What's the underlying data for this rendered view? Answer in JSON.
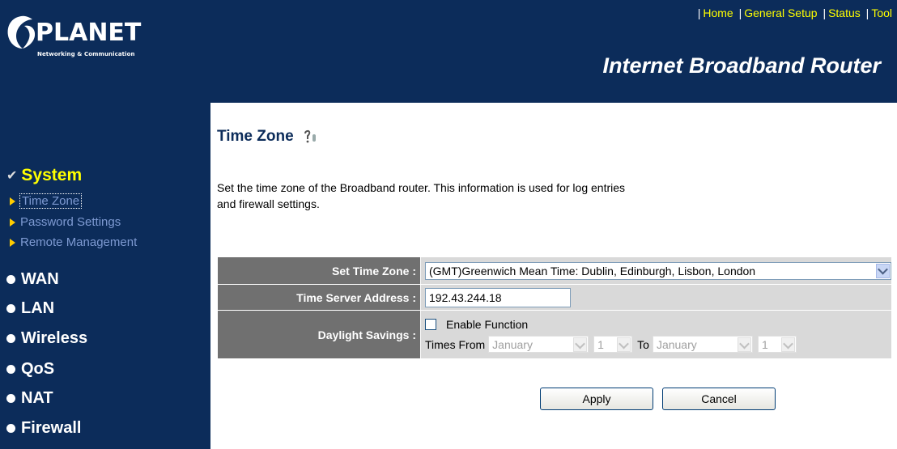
{
  "brand": {
    "name": "PLANET",
    "tagline": "Networking & Communication"
  },
  "top_nav": [
    "Home",
    "General Setup",
    "Status",
    "Tool"
  ],
  "product_title": "Internet Broadband Router",
  "sidebar": {
    "system_label": "System",
    "system_items": [
      "Time Zone",
      "Password Settings",
      "Remote Management"
    ],
    "sections": [
      "WAN",
      "LAN",
      "Wireless",
      "QoS",
      "NAT",
      "Firewall"
    ]
  },
  "page": {
    "title": "Time Zone",
    "description_line1": "Set the time zone of the Broadband router. This information is used for log entries",
    "description_line2": "and firewall settings."
  },
  "form": {
    "time_zone_label": "Set Time Zone :",
    "time_zone_value": "(GMT)Greenwich Mean Time: Dublin, Edinburgh, Lisbon, London",
    "server_label": "Time Server Address :",
    "server_value": "192.43.244.18",
    "daylight_label": "Daylight Savings :",
    "enable_label": "Enable Function",
    "enable_checked": false,
    "times_from_label": "Times From",
    "from_month": "January",
    "from_day": "1",
    "to_label": "To",
    "to_month": "January",
    "to_day": "1"
  },
  "buttons": {
    "apply": "Apply",
    "cancel": "Cancel"
  },
  "colors": {
    "header_bg": "#0c2c5a",
    "nav_link": "#ffff00",
    "label_bg": "#707070",
    "value_bg": "#d9d9d9"
  }
}
